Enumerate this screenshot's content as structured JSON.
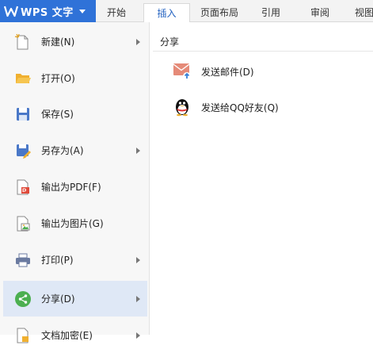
{
  "app": {
    "name": "WPS 文字"
  },
  "tabs": [
    {
      "label": "开始"
    },
    {
      "label": "插入"
    },
    {
      "label": "页面布局"
    },
    {
      "label": "引用"
    },
    {
      "label": "审阅"
    },
    {
      "label": "视图"
    }
  ],
  "active_tab": "插入",
  "menu": {
    "items": [
      {
        "label": "新建(N)",
        "icon": "new-doc-icon",
        "has_submenu": true
      },
      {
        "label": "打开(O)",
        "icon": "folder-icon",
        "has_submenu": false
      },
      {
        "label": "保存(S)",
        "icon": "save-icon",
        "has_submenu": false
      },
      {
        "label": "另存为(A)",
        "icon": "save-as-icon",
        "has_submenu": true
      },
      {
        "label": "输出为PDF(F)",
        "icon": "pdf-icon",
        "has_submenu": false
      },
      {
        "label": "输出为图片(G)",
        "icon": "image-export-icon",
        "has_submenu": false
      },
      {
        "label": "打印(P)",
        "icon": "printer-icon",
        "has_submenu": true
      },
      {
        "label": "分享(D)",
        "icon": "share-icon",
        "has_submenu": true,
        "selected": true
      },
      {
        "label": "文档加密(E)",
        "icon": "encrypt-icon",
        "has_submenu": true
      }
    ]
  },
  "panel": {
    "title": "分享",
    "items": [
      {
        "label": "发送邮件(D)",
        "icon": "mail-icon"
      },
      {
        "label": "发送给QQ好友(Q)",
        "icon": "qq-icon"
      }
    ]
  },
  "colors": {
    "app_button": "#2f72d8",
    "selected_item": "#dfe8f6",
    "share_green": "#4caf50"
  }
}
